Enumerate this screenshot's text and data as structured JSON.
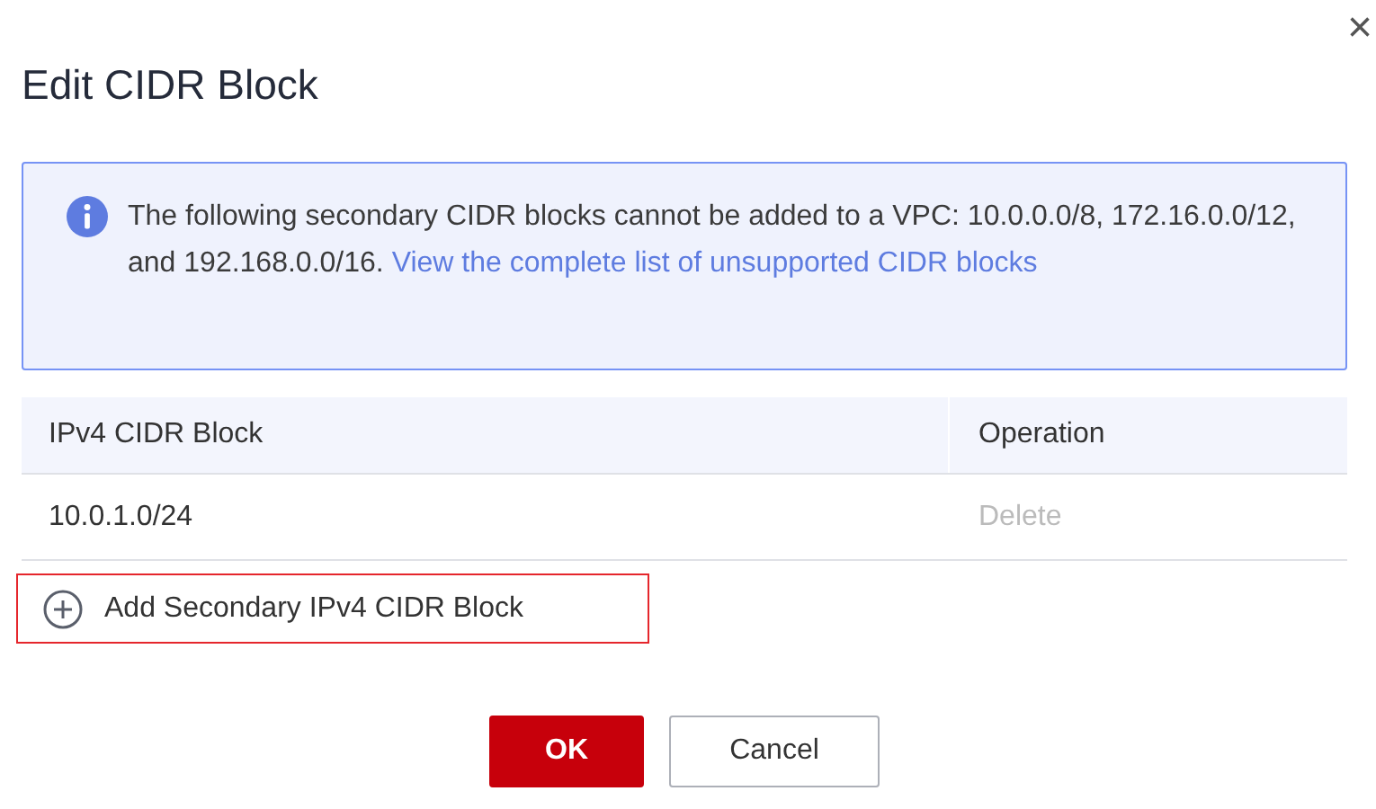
{
  "dialog": {
    "title": "Edit CIDR Block",
    "close": "×"
  },
  "notice": {
    "text": "The following secondary CIDR blocks cannot be added to a VPC: 10.0.0.0/8, 172.16.0.0/12, and 192.168.0.0/16.",
    "link": "View the complete list of unsupported CIDR blocks"
  },
  "table": {
    "columns": [
      "IPv4 CIDR Block",
      "Operation"
    ],
    "rows": [
      {
        "cidr": "10.0.1.0/24",
        "action": "Delete",
        "disabled": true
      }
    ]
  },
  "add_button": {
    "label": "Add Secondary IPv4 CIDR Block",
    "highlighted": true
  },
  "buttons": [
    {
      "label": "OK",
      "kind": "primary"
    },
    {
      "label": "Cancel",
      "kind": "secondary"
    }
  ]
}
